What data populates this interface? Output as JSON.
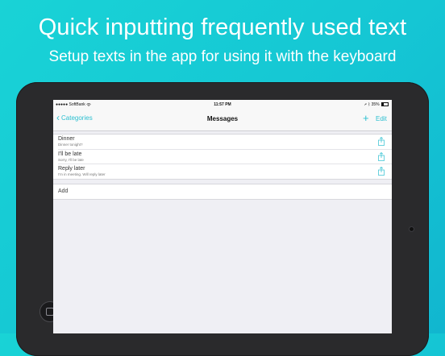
{
  "promo": {
    "headline": "Quick inputting frequently used text",
    "subline": "Setup texts in the app for using it with the keyboard"
  },
  "status_bar": {
    "carrier": "●●●●● SoftBank",
    "wifi": "wifi-icon",
    "time": "11:57 PM",
    "battery_text": "35%",
    "battery_level": 0.35
  },
  "nav": {
    "back_label": "Categories",
    "title": "Messages",
    "add_symbol": "+",
    "edit_label": "Edit"
  },
  "messages": [
    {
      "title": "Dinner",
      "subtitle": "Dinner tonight?"
    },
    {
      "title": "I'll be late",
      "subtitle": "Sorry, I'll be late"
    },
    {
      "title": "Reply later",
      "subtitle": "I'm in meeting. Will reply later"
    }
  ],
  "add_row": {
    "label": "Add"
  },
  "colors": {
    "background": "#17c9d5",
    "accent": "#2bbfd0",
    "device_frame": "#2a2a2c"
  }
}
